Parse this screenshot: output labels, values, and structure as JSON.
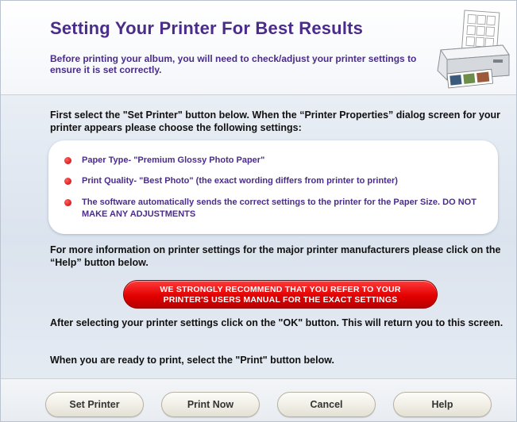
{
  "header": {
    "title": "Setting Your Printer For Best Results",
    "subtitle": "Before printing your album, you will need to check/adjust your printer settings to ensure it is set correctly."
  },
  "intro_text": "First select the \"Set Printer\" button below. When the “Printer Properties” dialog screen for your printer appears please choose the following settings:",
  "settings": [
    {
      "text": "Paper Type- \"Premium Glossy Photo Paper\""
    },
    {
      "text": "Print Quality- \"Best Photo\" (the exact wording differs from printer to printer)"
    },
    {
      "text": "The software automatically sends the correct settings to the printer for the Paper Size. DO NOT MAKE ANY ADJUSTMENTS"
    }
  ],
  "more_info_text": "For more information on printer settings for the major printer manufacturers please click on the “Help” button below.",
  "warning": {
    "line1": "WE STRONGLY RECOMMEND THAT YOU REFER TO YOUR",
    "line2": "PRINTER'S USERS MANUAL FOR THE EXACT SETTINGS"
  },
  "after_select_text": "After selecting your printer settings click on the \"OK\" button. This will return you to this screen.",
  "ready_text": "When you are ready to print, select the \"Print\" button below.",
  "buttons": {
    "set_printer": "Set Printer",
    "print_now": "Print Now",
    "cancel": "Cancel",
    "help": "Help"
  },
  "colors": {
    "title": "#4a2d8a",
    "bullet": "#cc0000",
    "warning": "#e30000"
  },
  "icons": {
    "printer": "printer-icon",
    "bullet": "bullet-icon"
  }
}
